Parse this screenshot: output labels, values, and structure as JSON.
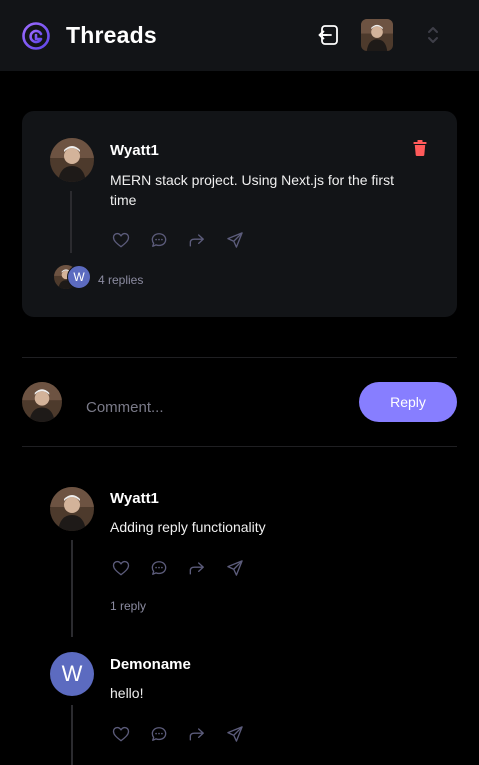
{
  "app": {
    "brand": "Threads"
  },
  "colors": {
    "accent": "#877eff",
    "delete": "#ff5a5a",
    "background": "#000000",
    "card": "#121417"
  },
  "icons": {
    "logo": "threads-logo-icon",
    "logout": "logout-icon",
    "switcher": "chevron-up-down-icon"
  },
  "thread": {
    "author": "Wyatt1",
    "content": "MERN stack project. Using Next.js for the first time",
    "replies_label": "4 replies",
    "reply_avatar_letter": "W"
  },
  "comment_form": {
    "placeholder": "Comment...",
    "button_label": "Reply"
  },
  "comments": [
    {
      "author": "Wyatt1",
      "content": "Adding reply functionality",
      "replies_label": "1 reply"
    },
    {
      "author": "Demoname",
      "avatar_letter": "W",
      "content": "hello!"
    }
  ]
}
